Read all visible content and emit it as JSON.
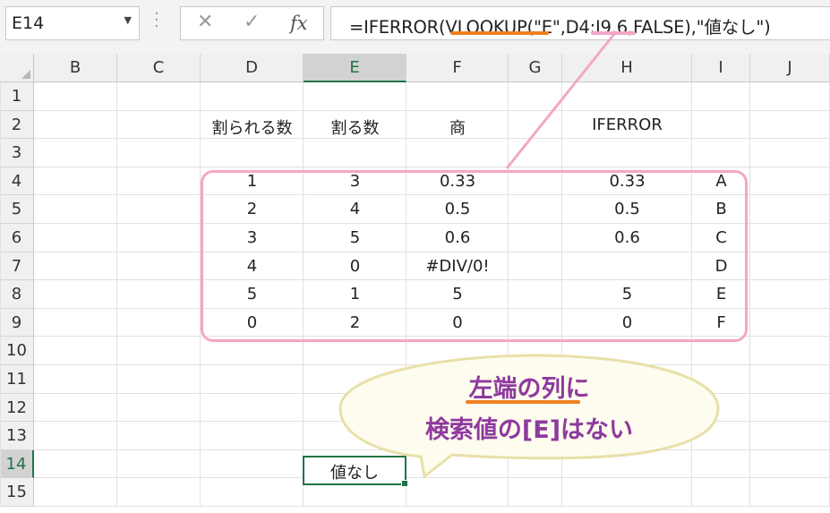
{
  "name_box": {
    "value": "E14"
  },
  "formula_bar": {
    "cancel_glyph": "✕",
    "enter_glyph": "✓",
    "fx_label": "fx",
    "formula": "=IFERROR(VLOOKUP(\"E\",D4:I9,6,FALSE),\"値なし\")"
  },
  "columns": [
    "B",
    "C",
    "D",
    "E",
    "F",
    "G",
    "H",
    "I",
    "J"
  ],
  "selected_column": "E",
  "rows": [
    "1",
    "2",
    "3",
    "4",
    "5",
    "6",
    "7",
    "8",
    "9",
    "10",
    "11",
    "12",
    "13",
    "14",
    "15"
  ],
  "selected_row": "14",
  "headers": {
    "d": "割られる数",
    "e": "割る数",
    "f": "商",
    "h": "IFERROR"
  },
  "table": [
    {
      "d": "1",
      "e": "3",
      "f": "0.33",
      "h": "0.33",
      "i": "A"
    },
    {
      "d": "2",
      "e": "4",
      "f": "0.5",
      "h": "0.5",
      "i": "B"
    },
    {
      "d": "3",
      "e": "5",
      "f": "0.6",
      "h": "0.6",
      "i": "C"
    },
    {
      "d": "4",
      "e": "0",
      "f": "#DIV/0!",
      "h": "",
      "i": "D"
    },
    {
      "d": "5",
      "e": "1",
      "f": "5",
      "h": "5",
      "i": "E"
    },
    {
      "d": "0",
      "e": "2",
      "f": "0",
      "h": "0",
      "i": "F"
    }
  ],
  "active_cell_value": "値なし",
  "callout": {
    "line1": "左端の列に",
    "line2": "検索値の[E]はない"
  },
  "colors": {
    "accent_green": "#217346",
    "pink": "#f4a6c6",
    "orange": "#f08020",
    "callout_text": "#8e3a9e",
    "bubble_fill": "#fdfcee",
    "bubble_border": "#e8e0a8"
  }
}
